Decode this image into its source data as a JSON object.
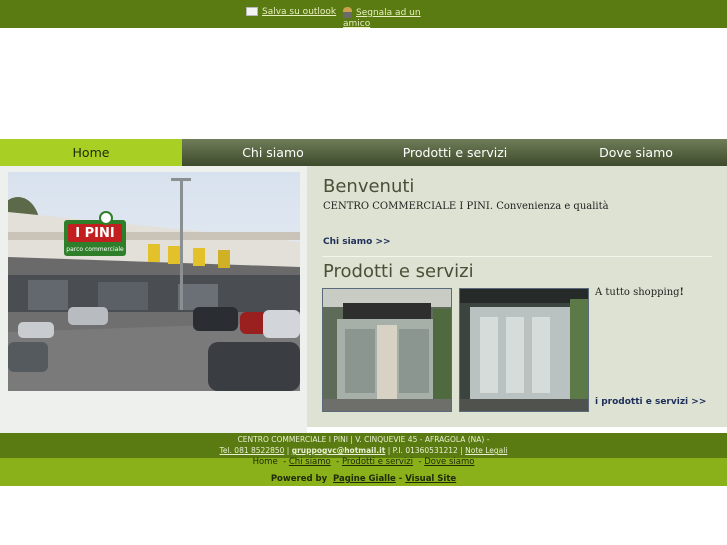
{
  "top_links": {
    "save_outlook": "Salva su outlook",
    "recommend": "Segnala ad un amico"
  },
  "nav": {
    "home": "Home",
    "about": "Chi siamo",
    "products": "Prodotti e servizi",
    "where": "Dove siamo"
  },
  "welcome": {
    "title": "Benvenuti",
    "company": "CENTRO COMMERCIALE I PINI",
    "tagline": "Convenienza e qualità",
    "more_link": "Chi siamo >>"
  },
  "products": {
    "title": "Prodotti e servizi",
    "text": "A tutto shopping",
    "text_end": "!",
    "more_link": "i prodotti e servizi >>"
  },
  "photo": {
    "sign_text": "I PINI",
    "sign_sub": "parco commerciale"
  },
  "footer": {
    "address": "CENTRO COMMERCIALE I PINI | V. CINQUEVIE 45 - AFRAGOLA (NA) -",
    "phone": "Tel. 081 8522850",
    "email": "gruppogvc@hotmail.it",
    "vat": "P.I. 01360531212",
    "legal": "Note Legali",
    "nav_home": "Home",
    "nav_about": "Chi siamo",
    "nav_products": "Prodotti e servizi",
    "nav_where": "Dove siamo",
    "powered_by": "Powered by",
    "pagine_gialle": "Pagine Gialle",
    "visual_site": "Visual Site"
  },
  "colors": {
    "header_green": "#5a7a12",
    "nav_active": "#a8d024",
    "content_bg": "#dde2d2",
    "link_blue": "#1e2e5a"
  }
}
